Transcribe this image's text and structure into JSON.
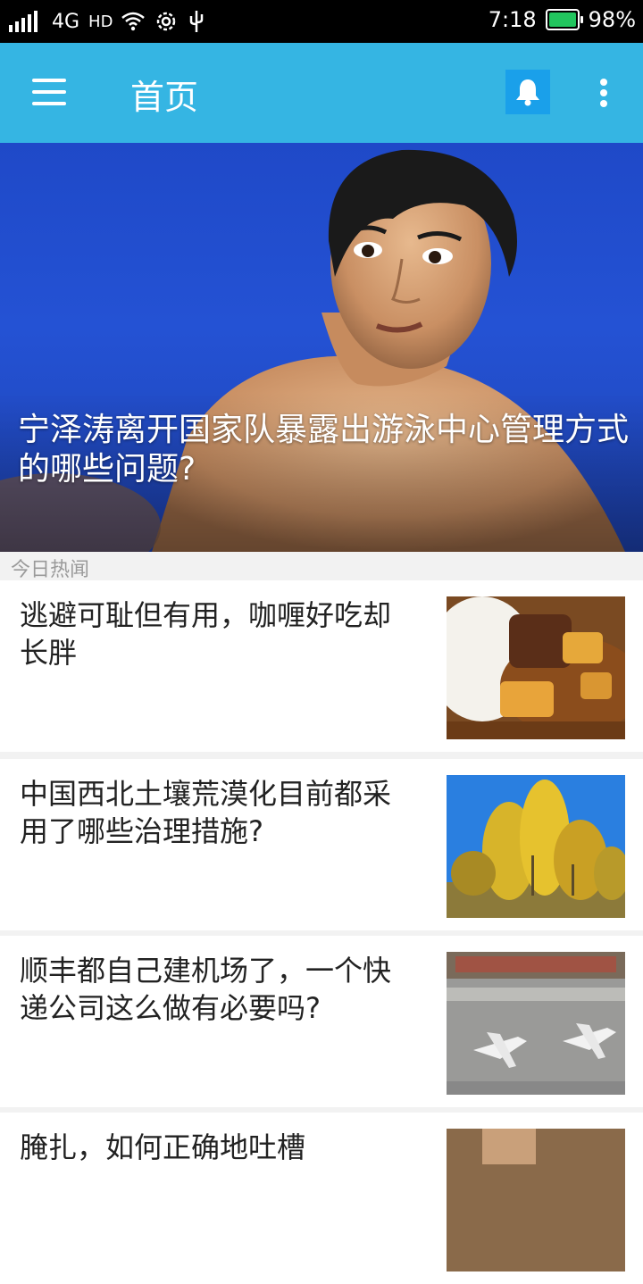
{
  "status_bar": {
    "network": "4G",
    "hd": "HD",
    "time": "7:18",
    "battery_percent": "98%",
    "battery_level": 0.98,
    "icons": [
      "signal-icon",
      "wifi-icon",
      "settings-icon",
      "usb-icon",
      "battery-icon"
    ]
  },
  "app_bar": {
    "title": "首页",
    "icons": [
      "menu-icon",
      "bell-icon",
      "more-vert-icon"
    ],
    "bell_bg_color": "#1aa0ea",
    "bar_color": "#35b5e3"
  },
  "hero": {
    "title": "宁泽涛离开国家队暴露出游泳中心管理方式的哪些问题?"
  },
  "section": {
    "label": "今日热闻"
  },
  "news": [
    {
      "headline": "逃避可耻但有用，咖喱好吃却长胖",
      "thumb": "curry-rice-photo"
    },
    {
      "headline": "中国西北土壤荒漠化目前都采用了哪些治理措施?",
      "thumb": "autumn-trees-photo"
    },
    {
      "headline": "顺丰都自己建机场了，一个快递公司这么做有必要吗?",
      "thumb": "airport-aerial-photo"
    },
    {
      "headline": "腌扎，如何正确地吐槽",
      "thumb": "partial-photo"
    }
  ]
}
